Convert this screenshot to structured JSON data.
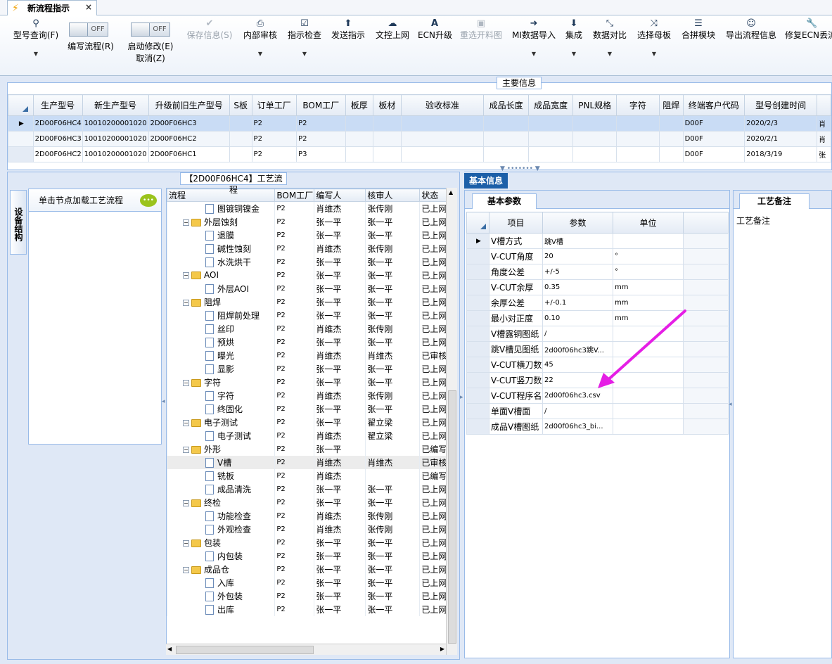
{
  "tab": {
    "title": "新流程指示",
    "close": "×"
  },
  "toolbar": {
    "items": [
      {
        "label": "型号查询(F)",
        "icon": "search-icon",
        "dropdown": true,
        "disabled": false
      },
      {
        "label": "保存信息(S)",
        "icon": "check-icon",
        "disabled": true
      },
      {
        "label": "内部审核",
        "icon": "print-icon",
        "dropdown": true,
        "disabled": false
      },
      {
        "label": "指示检查",
        "icon": "checkbox-icon",
        "dropdown": true,
        "disabled": false
      },
      {
        "label": "发送指示",
        "icon": "upload-icon",
        "disabled": false
      },
      {
        "label": "文控上网",
        "icon": "cloud-upload-icon",
        "disabled": false
      },
      {
        "label": "ECN升级",
        "icon": "font-icon",
        "disabled": false
      },
      {
        "label": "重选开料图",
        "icon": "image-icon",
        "disabled": true
      },
      {
        "label": "MI数据导入",
        "icon": "import-icon",
        "dropdown": true,
        "disabled": false
      },
      {
        "label": "集成",
        "icon": "download-icon",
        "dropdown": true,
        "disabled": false
      },
      {
        "label": "数据对比",
        "icon": "compress-icon",
        "dropdown": true,
        "disabled": false
      },
      {
        "label": "选择母板",
        "icon": "shuffle-icon",
        "dropdown": true,
        "disabled": false
      },
      {
        "label": "合拼模块",
        "icon": "list-icon",
        "disabled": false
      },
      {
        "label": "导出流程信息",
        "icon": "smile-icon",
        "disabled": false
      },
      {
        "label": "修复ECN丢流",
        "icon": "wrench-icon",
        "disabled": false
      }
    ],
    "toggle1": {
      "state": "OFF",
      "label": "编写流程(R)"
    },
    "toggle2": {
      "state": "OFF",
      "label1": "启动修改(E)",
      "label2": "取消(Z)"
    }
  },
  "main": {
    "title": "主要信息",
    "columns": [
      "生产型号",
      "新生产型号",
      "升级前旧生产型号",
      "S板",
      "订单工厂",
      "BOM工厂",
      "板厚",
      "板材",
      "验收标准",
      "成品长度",
      "成品宽度",
      "PNL规格",
      "字符",
      "阻焊",
      "终端客户代码",
      "型号创建时间",
      ""
    ],
    "rows": [
      [
        "2D00F06HC4",
        "10010200001020",
        "2D00F06HC3",
        "",
        "P2",
        "P2",
        "",
        "",
        "",
        "",
        "",
        "",
        "",
        "",
        "D00F",
        "2020/2/3",
        "肖"
      ],
      [
        "2D00F06HC3",
        "10010200001020",
        "2D00F06HC2",
        "",
        "P2",
        "P2",
        "",
        "",
        "",
        "",
        "",
        "",
        "",
        "",
        "D00F",
        "2020/2/1",
        "肖"
      ],
      [
        "2D00F06HC2",
        "10010200001020",
        "2D00F06HC1",
        "",
        "P2",
        "P3",
        "",
        "",
        "",
        "",
        "",
        "",
        "",
        "",
        "D00F",
        "2018/3/19",
        "张"
      ]
    ]
  },
  "process": {
    "title": "【2D00F06HC4】工艺流程",
    "side_tab": "设备结构",
    "node_hint": "单击节点加载工艺流程",
    "columns": [
      "流程",
      "BOM工厂",
      "编写人",
      "核审人",
      "状态"
    ],
    "rows": [
      {
        "level": 2,
        "name": "图镀铜镍金",
        "bom": "P2",
        "writer": "肖维杰",
        "reviewer": "张传刚",
        "status": "已上网"
      },
      {
        "level": 1,
        "name": "外层蚀刻",
        "bom": "P2",
        "writer": "张一平",
        "reviewer": "张一平",
        "status": "已上网"
      },
      {
        "level": 2,
        "name": "退膜",
        "bom": "P2",
        "writer": "张一平",
        "reviewer": "张一平",
        "status": "已上网"
      },
      {
        "level": 2,
        "name": "碱性蚀刻",
        "bom": "P2",
        "writer": "肖维杰",
        "reviewer": "张传刚",
        "status": "已上网"
      },
      {
        "level": 2,
        "name": "水洗烘干",
        "bom": "P2",
        "writer": "张一平",
        "reviewer": "张一平",
        "status": "已上网"
      },
      {
        "level": 1,
        "name": "AOI",
        "bom": "P2",
        "writer": "张一平",
        "reviewer": "张一平",
        "status": "已上网"
      },
      {
        "level": 2,
        "name": "外层AOI",
        "bom": "P2",
        "writer": "张一平",
        "reviewer": "张一平",
        "status": "已上网"
      },
      {
        "level": 1,
        "name": "阻焊",
        "bom": "P2",
        "writer": "张一平",
        "reviewer": "张一平",
        "status": "已上网"
      },
      {
        "level": 2,
        "name": "阻焊前处理",
        "bom": "P2",
        "writer": "张一平",
        "reviewer": "张一平",
        "status": "已上网"
      },
      {
        "level": 2,
        "name": "丝印",
        "bom": "P2",
        "writer": "肖维杰",
        "reviewer": "张传刚",
        "status": "已上网"
      },
      {
        "level": 2,
        "name": "预烘",
        "bom": "P2",
        "writer": "张一平",
        "reviewer": "张一平",
        "status": "已上网"
      },
      {
        "level": 2,
        "name": "曝光",
        "bom": "P2",
        "writer": "肖维杰",
        "reviewer": "肖维杰",
        "status": "已审核"
      },
      {
        "level": 2,
        "name": "显影",
        "bom": "P2",
        "writer": "张一平",
        "reviewer": "张一平",
        "status": "已上网"
      },
      {
        "level": 1,
        "name": "字符",
        "bom": "P2",
        "writer": "张一平",
        "reviewer": "张一平",
        "status": "已上网"
      },
      {
        "level": 2,
        "name": "字符",
        "bom": "P2",
        "writer": "肖维杰",
        "reviewer": "张传刚",
        "status": "已上网"
      },
      {
        "level": 2,
        "name": "终固化",
        "bom": "P2",
        "writer": "张一平",
        "reviewer": "张一平",
        "status": "已上网"
      },
      {
        "level": 1,
        "name": "电子测试",
        "bom": "P2",
        "writer": "张一平",
        "reviewer": "翟立梁",
        "status": "已上网"
      },
      {
        "level": 2,
        "name": "电子测试",
        "bom": "P2",
        "writer": "肖维杰",
        "reviewer": "翟立梁",
        "status": "已上网"
      },
      {
        "level": 1,
        "name": "外形",
        "bom": "P2",
        "writer": "张一平",
        "reviewer": "",
        "status": "已编写"
      },
      {
        "level": 2,
        "name": "V槽",
        "bom": "P2",
        "writer": "肖维杰",
        "reviewer": "肖维杰",
        "status": "已审核",
        "highlight": true
      },
      {
        "level": 2,
        "name": "铣板",
        "bom": "P2",
        "writer": "肖维杰",
        "reviewer": "",
        "status": "已编写"
      },
      {
        "level": 2,
        "name": "成品清洗",
        "bom": "P2",
        "writer": "张一平",
        "reviewer": "张一平",
        "status": "已上网"
      },
      {
        "level": 1,
        "name": "终检",
        "bom": "P2",
        "writer": "张一平",
        "reviewer": "张一平",
        "status": "已上网"
      },
      {
        "level": 2,
        "name": "功能检查",
        "bom": "P2",
        "writer": "肖维杰",
        "reviewer": "张传刚",
        "status": "已上网"
      },
      {
        "level": 2,
        "name": "外观检查",
        "bom": "P2",
        "writer": "肖维杰",
        "reviewer": "张传刚",
        "status": "已上网"
      },
      {
        "level": 1,
        "name": "包装",
        "bom": "P2",
        "writer": "张一平",
        "reviewer": "张一平",
        "status": "已上网"
      },
      {
        "level": 2,
        "name": "内包装",
        "bom": "P2",
        "writer": "张一平",
        "reviewer": "张一平",
        "status": "已上网"
      },
      {
        "level": 1,
        "name": "成品仓",
        "bom": "P2",
        "writer": "张一平",
        "reviewer": "张一平",
        "status": "已上网"
      },
      {
        "level": 2,
        "name": "入库",
        "bom": "P2",
        "writer": "张一平",
        "reviewer": "张一平",
        "status": "已上网"
      },
      {
        "level": 2,
        "name": "外包装",
        "bom": "P2",
        "writer": "张一平",
        "reviewer": "张一平",
        "status": "已上网"
      },
      {
        "level": 2,
        "name": "出库",
        "bom": "P2",
        "writer": "张一平",
        "reviewer": "张一平",
        "status": "已上网"
      }
    ]
  },
  "basic": {
    "header_tab": "基本信息",
    "tab": "基本参数",
    "columns": [
      "项目",
      "参数",
      "单位"
    ],
    "rows": [
      {
        "item": "V槽方式",
        "param": "跳V槽",
        "unit": ""
      },
      {
        "item": "V-CUT角度",
        "param": "20",
        "unit": "°"
      },
      {
        "item": "角度公差",
        "param": "+/-5",
        "unit": "°"
      },
      {
        "item": "V-CUT余厚",
        "param": "0.35",
        "unit": "mm"
      },
      {
        "item": "余厚公差",
        "param": "+/-0.1",
        "unit": "mm"
      },
      {
        "item": "最小对正度",
        "param": "0.10",
        "unit": "mm"
      },
      {
        "item": "V槽露铜图纸",
        "param": "/",
        "unit": ""
      },
      {
        "item": "跳V槽见图纸",
        "param": "2d00f06hc3跳V...",
        "unit": ""
      },
      {
        "item": "V-CUT横刀数",
        "param": "45",
        "unit": ""
      },
      {
        "item": "V-CUT竖刀数",
        "param": "22",
        "unit": ""
      },
      {
        "item": "V-CUT程序名",
        "param": "2d00f06hc3.csv",
        "unit": ""
      },
      {
        "item": "单面V槽面",
        "param": "/",
        "unit": ""
      },
      {
        "item": "成品V槽图纸",
        "param": "2d00f06hc3_bi...",
        "unit": ""
      }
    ]
  },
  "remark": {
    "tab": "工艺备注",
    "label": "工艺备注"
  },
  "annotation_color": "#e51ee5"
}
